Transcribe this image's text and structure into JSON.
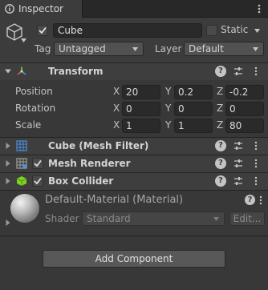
{
  "tab": {
    "label": "Inspector",
    "icon": "info-icon"
  },
  "gameobject": {
    "icon": "cube-icon",
    "active": true,
    "name": "Cube",
    "static_label": "Static",
    "static_checked": false,
    "tag_label": "Tag",
    "tag_value": "Untagged",
    "layer_label": "Layer",
    "layer_value": "Default"
  },
  "components": [
    {
      "title": "Transform",
      "icon": "transform-icon",
      "expanded": true
    },
    {
      "title": "Cube (Mesh Filter)",
      "icon": "mesh-filter-icon",
      "expanded": false
    },
    {
      "title": "Mesh Renderer",
      "icon": "mesh-renderer-icon",
      "enabled": true,
      "expanded": false
    },
    {
      "title": "Box Collider",
      "icon": "box-collider-icon",
      "enabled": true,
      "expanded": false
    }
  ],
  "transform": {
    "rows": [
      {
        "label": "Position",
        "x": "20",
        "y": "0.2",
        "z": "-0.2"
      },
      {
        "label": "Rotation",
        "x": "0",
        "y": "0",
        "z": "0"
      },
      {
        "label": "Scale",
        "x": "1",
        "y": "1",
        "z": "80"
      }
    ],
    "axes": {
      "x": "X",
      "y": "Y",
      "z": "Z"
    }
  },
  "header_buttons": {
    "help": "?",
    "presets_icon": "sliders-icon",
    "menu_icon": "kebab-icon"
  },
  "material": {
    "title": "Default-Material (Material)",
    "shader_label": "Shader",
    "shader_value": "Standard",
    "edit_label": "Edit..."
  },
  "add_component_label": "Add Component",
  "colors": {
    "panel": "#383838",
    "header": "#3e3e3e",
    "field": "#2a2a2a",
    "transform_icon_red": "#e05a48",
    "transform_icon_blue": "#4a90e2",
    "collider_green": "#7ed321"
  }
}
